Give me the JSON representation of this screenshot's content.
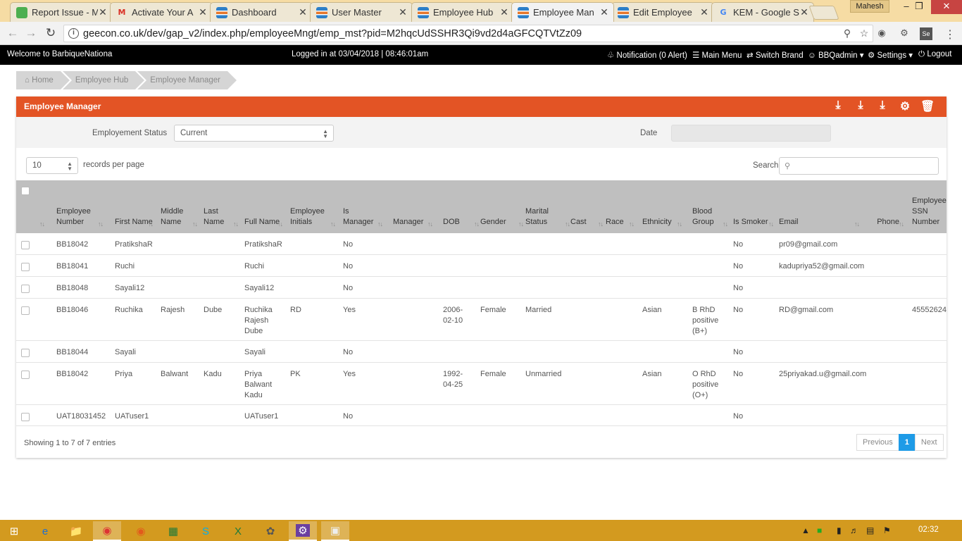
{
  "browser": {
    "tabs": [
      {
        "title": "Report Issue - M",
        "icon": "bug-icon"
      },
      {
        "title": "Activate Your A",
        "icon": "gmail-icon"
      },
      {
        "title": "Dashboard",
        "icon": "db-icon"
      },
      {
        "title": "User Master",
        "icon": "db-icon"
      },
      {
        "title": "Employee Hub",
        "icon": "db-icon"
      },
      {
        "title": "Employee Man",
        "icon": "db-icon",
        "active": true
      },
      {
        "title": "Edit Employee",
        "icon": "db-icon"
      },
      {
        "title": "KEM - Google S",
        "icon": "google-icon"
      }
    ],
    "window_user": "Mahesh",
    "url": "geecon.co.uk/dev/gap_v2/index.php/employeeMngt/emp_mst?pid=M2hqcUdSSHR3Qi9vd2d4aGFCQTVtZz09"
  },
  "app_header": {
    "welcome": "Welcome to BarbiqueNationa",
    "login_info": "Logged in at 03/04/2018 | 08:46:01am",
    "notification": "Notification (0 Alert)",
    "main_menu": "Main Menu",
    "switch_brand": "Switch Brand",
    "user": "BBQadmin",
    "settings": "Settings",
    "logout": "Logout"
  },
  "breadcrumb": [
    "Home",
    "Employee Hub",
    "Employee Manager"
  ],
  "panel": {
    "title": "Employee Manager",
    "employment_status_label": "Employement Status",
    "employment_status_value": "Current",
    "date_label": "Date",
    "records_per_page": "10",
    "records_per_page_label": "records per page",
    "search_label": "Search:"
  },
  "table": {
    "columns": [
      "Employee Number",
      "First Name",
      "Middle Name",
      "Last Name",
      "Full Name",
      "Employee Initials",
      "Is Manager",
      "Manager",
      "DOB",
      "Gender",
      "Marital Status",
      "Cast",
      "Race",
      "Ethnicity",
      "Blood Group",
      "Is Smoker",
      "Email",
      "Phone",
      "Employee SSN Number"
    ],
    "rows": [
      {
        "emp_no": "BB18042",
        "first": "PratikshaR",
        "middle": "",
        "last": "",
        "full": "PratikshaR",
        "initials": "",
        "is_manager": "No",
        "dob": "",
        "gender": "",
        "marital": "",
        "ethnicity": "",
        "blood": "",
        "smoker": "No",
        "email": "pr09@gmail.com",
        "ssn": ""
      },
      {
        "emp_no": "BB18041",
        "first": "Ruchi",
        "middle": "",
        "last": "",
        "full": "Ruchi",
        "initials": "",
        "is_manager": "No",
        "dob": "",
        "gender": "",
        "marital": "",
        "ethnicity": "",
        "blood": "",
        "smoker": "No",
        "email": "kadupriya52@gmail.com",
        "ssn": ""
      },
      {
        "emp_no": "BB18048",
        "first": "Sayali12",
        "middle": "",
        "last": "",
        "full": "Sayali12",
        "initials": "",
        "is_manager": "No",
        "dob": "",
        "gender": "",
        "marital": "",
        "ethnicity": "",
        "blood": "",
        "smoker": "No",
        "email": "",
        "ssn": ""
      },
      {
        "emp_no": "BB18046",
        "first": "Ruchika",
        "middle": "Rajesh",
        "last": "Dube",
        "full": "Ruchika Rajesh Dube",
        "initials": "RD",
        "is_manager": "Yes",
        "dob": "2006-02-10",
        "gender": "Female",
        "marital": "Married",
        "ethnicity": "Asian",
        "blood": "B RhD positive (B+)",
        "smoker": "No",
        "email": "RD@gmail.com",
        "ssn": "45552624"
      },
      {
        "emp_no": "BB18044",
        "first": "Sayali",
        "middle": "",
        "last": "",
        "full": "Sayali",
        "initials": "",
        "is_manager": "No",
        "dob": "",
        "gender": "",
        "marital": "",
        "ethnicity": "",
        "blood": "",
        "smoker": "No",
        "email": "",
        "ssn": ""
      },
      {
        "emp_no": "BB18042",
        "first": "Priya",
        "middle": "Balwant",
        "last": "Kadu",
        "full": "Priya Balwant Kadu",
        "initials": "PK",
        "is_manager": "Yes",
        "dob": "1992-04-25",
        "gender": "Female",
        "marital": "Unmarried",
        "ethnicity": "Asian",
        "blood": "O RhD positive (O+)",
        "smoker": "No",
        "email": "25priyakad.u@gmail.com",
        "ssn": ""
      },
      {
        "emp_no": "UAT18031452",
        "first": "UATuser1",
        "middle": "",
        "last": "",
        "full": "UATuser1",
        "initials": "",
        "is_manager": "No",
        "dob": "",
        "gender": "",
        "marital": "",
        "ethnicity": "",
        "blood": "",
        "smoker": "No",
        "email": "",
        "ssn": ""
      }
    ],
    "info": "Showing 1 to 7 of 7 entries",
    "pager": {
      "previous": "Previous",
      "current": "1",
      "next": "Next"
    }
  },
  "taskbar": {
    "clock": "02:32"
  },
  "colors": {
    "accent": "#e35425",
    "header_bg": "#000000",
    "table_head": "#bfbfbf",
    "page_active": "#1e9be7",
    "taskbar": "#d39a1f"
  }
}
